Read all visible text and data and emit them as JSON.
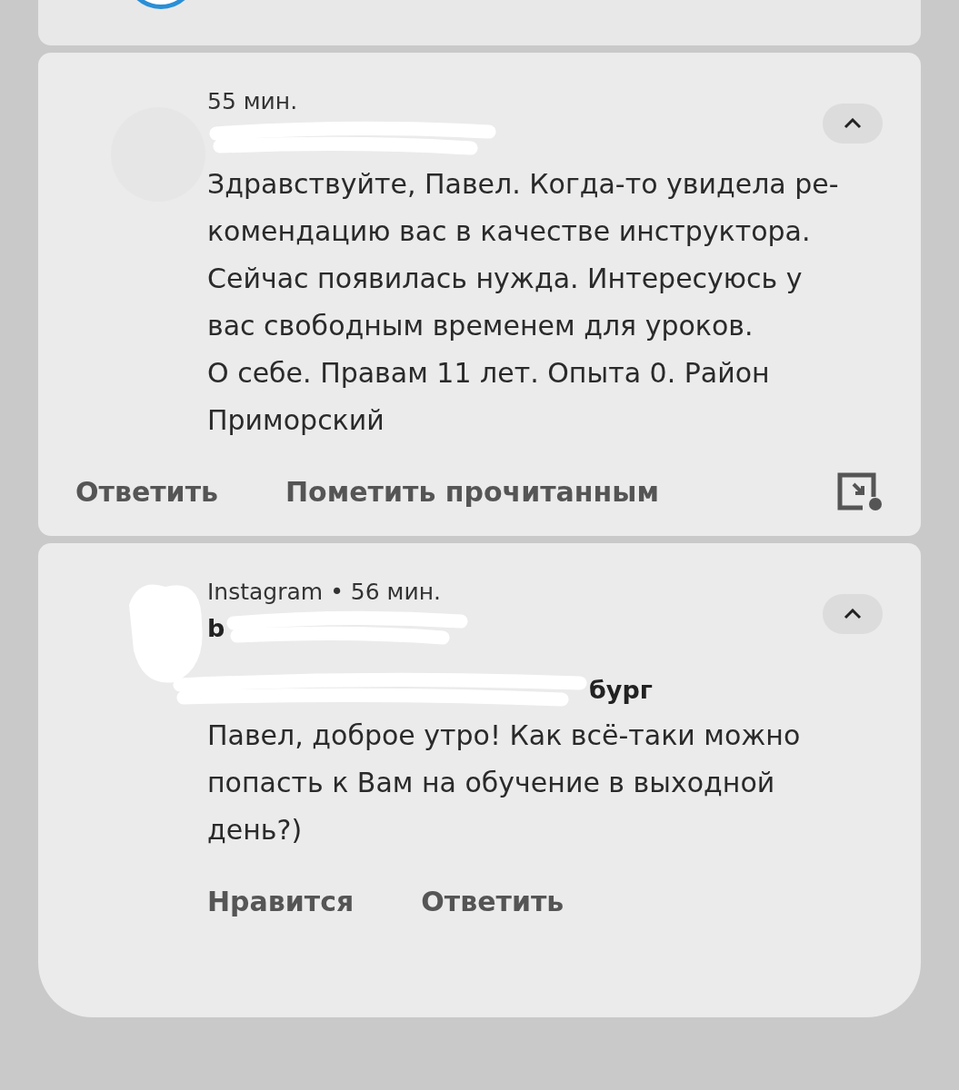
{
  "notifications": [
    {
      "meta": "55 мин.",
      "expanded": true,
      "body_lines": [
        "Здравствуйте, Павел. Когда-то увидела ре-",
        "комендацию вас в качестве инструктора.",
        "Сейчас появилась нужда. Интересуюсь у",
        "вас свободным временем для уроков.",
        "О себе. Правам 11 лет. Опыта 0. Район",
        "Приморский"
      ],
      "actions": [
        "Ответить",
        "Пометить прочитанным"
      ],
      "kind": "message"
    },
    {
      "meta": "Instagram • 56 мин.",
      "expanded": true,
      "sender_visible": "b",
      "subtitle_visible": "бург",
      "body_lines": [
        "Павел, доброе утро! Как всё-таки можно",
        "попасть к Вам на обучение в выходной",
        "день?)"
      ],
      "actions": [
        "Нравится",
        "Ответить"
      ],
      "kind": "social"
    }
  ]
}
